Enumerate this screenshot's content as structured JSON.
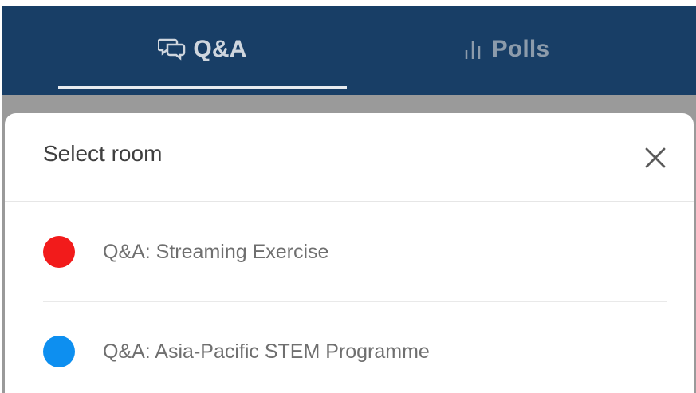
{
  "tabs": [
    {
      "label": "Q&A",
      "icon": "chat-bubbles-icon",
      "active": true
    },
    {
      "label": "Polls",
      "icon": "bar-chart-icon",
      "active": false
    }
  ],
  "modal": {
    "title": "Select room",
    "close_icon": "close-icon"
  },
  "rooms": [
    {
      "label": "Q&A: Streaming Exercise",
      "color": "#f21b1b"
    },
    {
      "label": "Q&A: Asia-Pacific STEM Programme",
      "color": "#0d8ff0"
    }
  ],
  "colors": {
    "topbar": "#183e66",
    "overlay": "#9a9a9a",
    "modal": "#ffffff"
  }
}
